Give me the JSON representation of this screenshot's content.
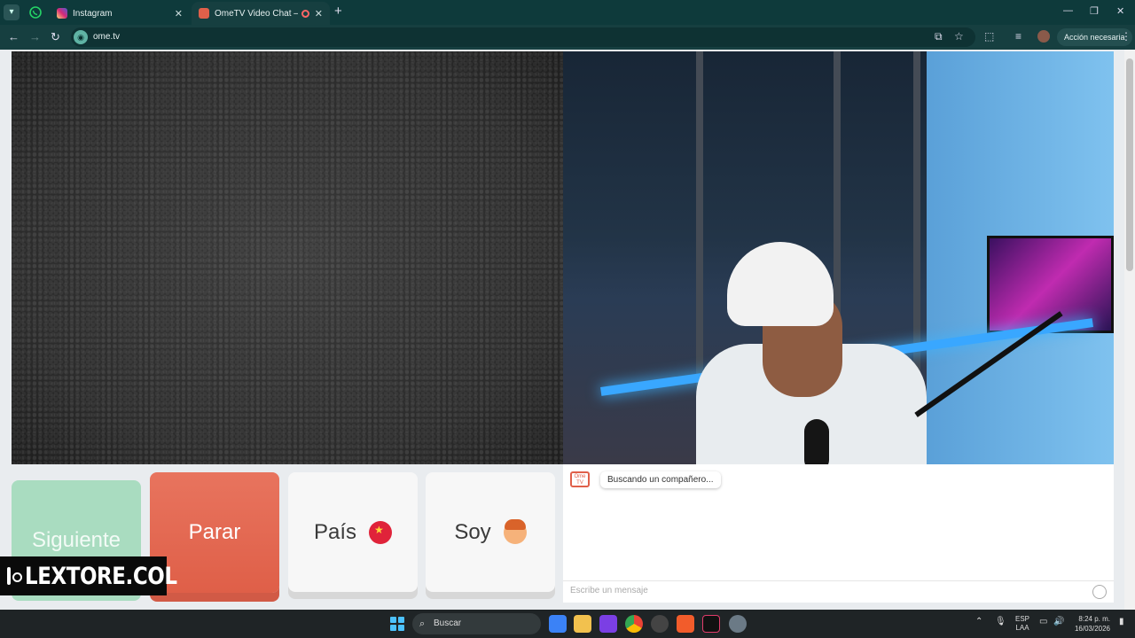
{
  "browser": {
    "tabs": [
      {
        "title": "Instagram",
        "active": false,
        "favicon_color": "#e1306c"
      },
      {
        "title": "OmeTV Video Chat — Ome",
        "active": true,
        "favicon_color": "#e0604a"
      }
    ],
    "close_glyph": "✕",
    "new_tab_glyph": "+",
    "url": "ome.tv",
    "action_label": "Acción necesaria",
    "icons": [
      "tab-search-icon",
      "whatsapp-icon",
      "back-icon",
      "forward-icon",
      "reload-icon",
      "install-icon",
      "star-icon",
      "extensions-icon",
      "media-icon",
      "profile-icon",
      "menu-icon"
    ]
  },
  "controls": {
    "next_label": "Siguiente",
    "stop_label": "Parar",
    "country_label": "País",
    "iam_label": "Soy"
  },
  "chat": {
    "logo_text": "Ome TV",
    "status_message": "Buscando un compañero...",
    "input_placeholder": "Escribe un mensaje"
  },
  "watermark": {
    "text": "LEXTORE.COL"
  },
  "taskbar": {
    "search_label": "Buscar",
    "lang_top": "ESP",
    "lang_bottom": "LAA",
    "time": "8:24 p. m.",
    "date": "16/03/2026"
  },
  "colors": {
    "chrome_dark": "#0e3a3b",
    "next_button": "#a9dcc0",
    "stop_button": "#df5f48",
    "neutral_button": "#f7f7f7"
  }
}
